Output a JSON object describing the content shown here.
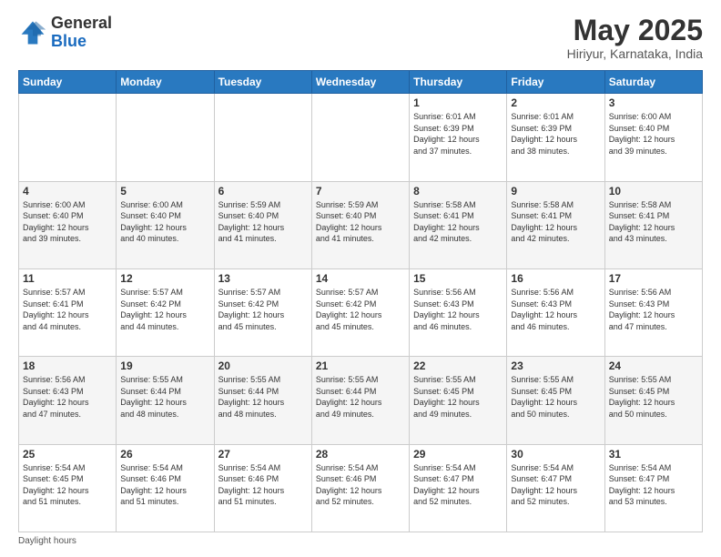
{
  "logo": {
    "general": "General",
    "blue": "Blue"
  },
  "header": {
    "month": "May 2025",
    "location": "Hiriyur, Karnataka, India"
  },
  "days_of_week": [
    "Sunday",
    "Monday",
    "Tuesday",
    "Wednesday",
    "Thursday",
    "Friday",
    "Saturday"
  ],
  "weeks": [
    [
      {
        "day": "",
        "info": ""
      },
      {
        "day": "",
        "info": ""
      },
      {
        "day": "",
        "info": ""
      },
      {
        "day": "",
        "info": ""
      },
      {
        "day": "1",
        "info": "Sunrise: 6:01 AM\nSunset: 6:39 PM\nDaylight: 12 hours\nand 37 minutes."
      },
      {
        "day": "2",
        "info": "Sunrise: 6:01 AM\nSunset: 6:39 PM\nDaylight: 12 hours\nand 38 minutes."
      },
      {
        "day": "3",
        "info": "Sunrise: 6:00 AM\nSunset: 6:40 PM\nDaylight: 12 hours\nand 39 minutes."
      }
    ],
    [
      {
        "day": "4",
        "info": "Sunrise: 6:00 AM\nSunset: 6:40 PM\nDaylight: 12 hours\nand 39 minutes."
      },
      {
        "day": "5",
        "info": "Sunrise: 6:00 AM\nSunset: 6:40 PM\nDaylight: 12 hours\nand 40 minutes."
      },
      {
        "day": "6",
        "info": "Sunrise: 5:59 AM\nSunset: 6:40 PM\nDaylight: 12 hours\nand 41 minutes."
      },
      {
        "day": "7",
        "info": "Sunrise: 5:59 AM\nSunset: 6:40 PM\nDaylight: 12 hours\nand 41 minutes."
      },
      {
        "day": "8",
        "info": "Sunrise: 5:58 AM\nSunset: 6:41 PM\nDaylight: 12 hours\nand 42 minutes."
      },
      {
        "day": "9",
        "info": "Sunrise: 5:58 AM\nSunset: 6:41 PM\nDaylight: 12 hours\nand 42 minutes."
      },
      {
        "day": "10",
        "info": "Sunrise: 5:58 AM\nSunset: 6:41 PM\nDaylight: 12 hours\nand 43 minutes."
      }
    ],
    [
      {
        "day": "11",
        "info": "Sunrise: 5:57 AM\nSunset: 6:41 PM\nDaylight: 12 hours\nand 44 minutes."
      },
      {
        "day": "12",
        "info": "Sunrise: 5:57 AM\nSunset: 6:42 PM\nDaylight: 12 hours\nand 44 minutes."
      },
      {
        "day": "13",
        "info": "Sunrise: 5:57 AM\nSunset: 6:42 PM\nDaylight: 12 hours\nand 45 minutes."
      },
      {
        "day": "14",
        "info": "Sunrise: 5:57 AM\nSunset: 6:42 PM\nDaylight: 12 hours\nand 45 minutes."
      },
      {
        "day": "15",
        "info": "Sunrise: 5:56 AM\nSunset: 6:43 PM\nDaylight: 12 hours\nand 46 minutes."
      },
      {
        "day": "16",
        "info": "Sunrise: 5:56 AM\nSunset: 6:43 PM\nDaylight: 12 hours\nand 46 minutes."
      },
      {
        "day": "17",
        "info": "Sunrise: 5:56 AM\nSunset: 6:43 PM\nDaylight: 12 hours\nand 47 minutes."
      }
    ],
    [
      {
        "day": "18",
        "info": "Sunrise: 5:56 AM\nSunset: 6:43 PM\nDaylight: 12 hours\nand 47 minutes."
      },
      {
        "day": "19",
        "info": "Sunrise: 5:55 AM\nSunset: 6:44 PM\nDaylight: 12 hours\nand 48 minutes."
      },
      {
        "day": "20",
        "info": "Sunrise: 5:55 AM\nSunset: 6:44 PM\nDaylight: 12 hours\nand 48 minutes."
      },
      {
        "day": "21",
        "info": "Sunrise: 5:55 AM\nSunset: 6:44 PM\nDaylight: 12 hours\nand 49 minutes."
      },
      {
        "day": "22",
        "info": "Sunrise: 5:55 AM\nSunset: 6:45 PM\nDaylight: 12 hours\nand 49 minutes."
      },
      {
        "day": "23",
        "info": "Sunrise: 5:55 AM\nSunset: 6:45 PM\nDaylight: 12 hours\nand 50 minutes."
      },
      {
        "day": "24",
        "info": "Sunrise: 5:55 AM\nSunset: 6:45 PM\nDaylight: 12 hours\nand 50 minutes."
      }
    ],
    [
      {
        "day": "25",
        "info": "Sunrise: 5:54 AM\nSunset: 6:45 PM\nDaylight: 12 hours\nand 51 minutes."
      },
      {
        "day": "26",
        "info": "Sunrise: 5:54 AM\nSunset: 6:46 PM\nDaylight: 12 hours\nand 51 minutes."
      },
      {
        "day": "27",
        "info": "Sunrise: 5:54 AM\nSunset: 6:46 PM\nDaylight: 12 hours\nand 51 minutes."
      },
      {
        "day": "28",
        "info": "Sunrise: 5:54 AM\nSunset: 6:46 PM\nDaylight: 12 hours\nand 52 minutes."
      },
      {
        "day": "29",
        "info": "Sunrise: 5:54 AM\nSunset: 6:47 PM\nDaylight: 12 hours\nand 52 minutes."
      },
      {
        "day": "30",
        "info": "Sunrise: 5:54 AM\nSunset: 6:47 PM\nDaylight: 12 hours\nand 52 minutes."
      },
      {
        "day": "31",
        "info": "Sunrise: 5:54 AM\nSunset: 6:47 PM\nDaylight: 12 hours\nand 53 minutes."
      }
    ]
  ],
  "footer": {
    "note": "Daylight hours"
  }
}
